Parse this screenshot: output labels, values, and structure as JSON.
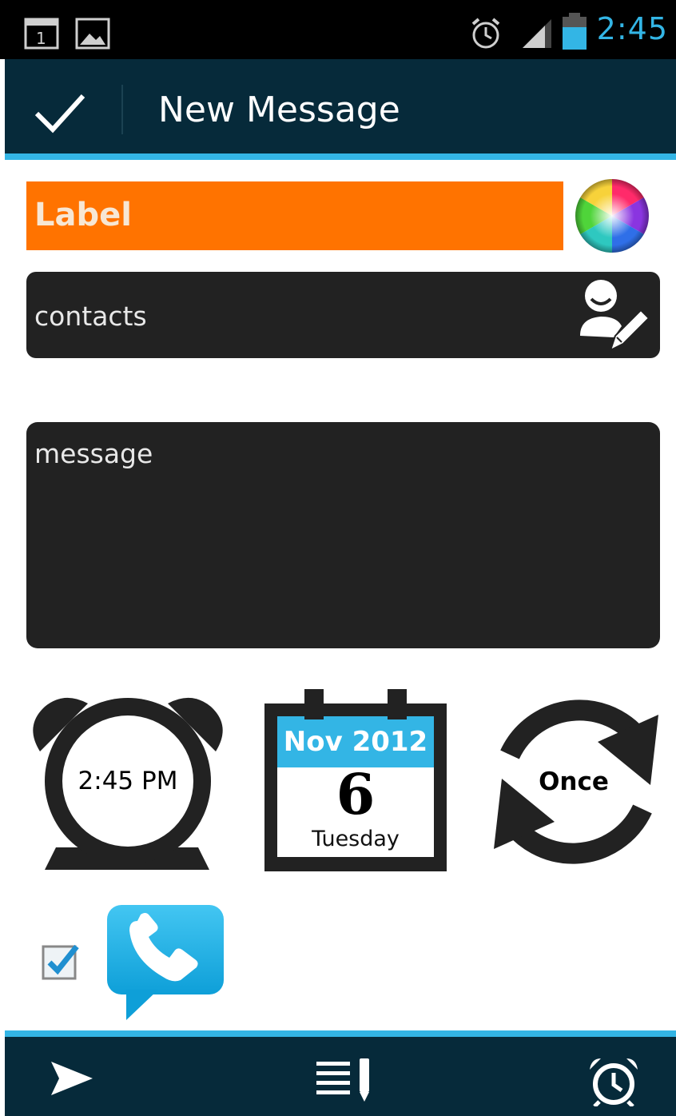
{
  "status_bar": {
    "time": "2:45",
    "notification_icons": [
      "calendar-notification-icon",
      "gallery-notification-icon"
    ],
    "system_icons": [
      "alarm-icon",
      "signal-icon",
      "battery-icon"
    ],
    "accent_color": "#33b5e5"
  },
  "action_bar": {
    "title": "New Message",
    "done_icon": "checkmark-icon",
    "background_color": "#062a3a"
  },
  "label": {
    "text": "Label",
    "color": "#ff7300",
    "picker_icon": "color-wheel-icon"
  },
  "contacts": {
    "placeholder": "contacts",
    "icon": "contact-edit-icon"
  },
  "message": {
    "placeholder": "message"
  },
  "schedule": {
    "time": "2:45 PM",
    "date_month_year": "Nov 2012",
    "date_day": "6",
    "date_weekday": "Tuesday",
    "repeat": "Once",
    "icons": [
      "alarm-clock-icon",
      "calendar-icon",
      "repeat-icon"
    ]
  },
  "options": {
    "checkbox_checked": true,
    "phone_icon": "phone-message-icon",
    "phone_icon_color": "#1cb0e6"
  },
  "bottom_bar": {
    "icons": [
      "send-icon",
      "compose-list-icon",
      "alarm-icon"
    ]
  }
}
